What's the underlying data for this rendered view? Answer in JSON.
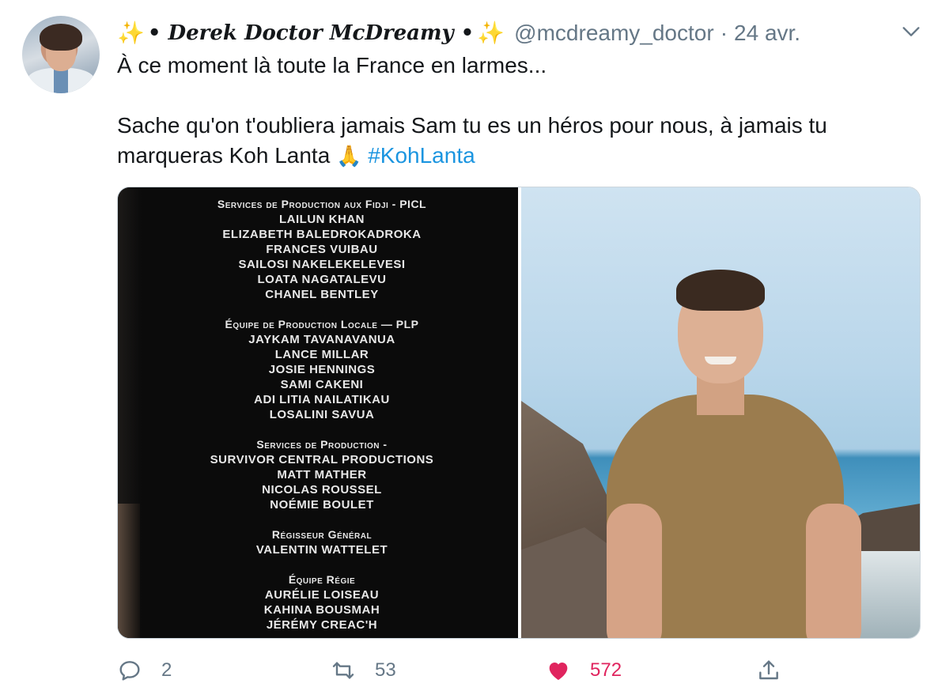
{
  "tweet": {
    "display_name": "• Derek Doctor McDreamy •",
    "sparkle_left": "✨",
    "sparkle_right": "✨",
    "handle": "@mcdreamy_doctor",
    "separator": "·",
    "date": "24 avr.",
    "text_line1": "À ce moment là toute la France en larmes...",
    "text_line2": "Sache qu'on t'oubliera jamais Sam tu es un héros pour nous, à jamais tu",
    "text_line3": "marqueras Koh Lanta",
    "emoji": "🙏",
    "hashtag": "#KohLanta"
  },
  "credits": {
    "sections": [
      {
        "heading": "Services de Production aux Fidji - PICL",
        "names": [
          "LAILUN KHAN",
          "ELIZABETH BALEDROKADROKA",
          "FRANCES VUIBAU",
          "SAILOSI NAKELEKELEVESI",
          "LOATA NAGATALEVU",
          "CHANEL BENTLEY"
        ]
      },
      {
        "heading": "Équipe de Production Locale — PLP",
        "names": [
          "JAYKAM TAVANAVANUA",
          "LANCE MILLAR",
          "JOSIE HENNINGS",
          "SAMI CAKENI",
          "ADI LITIA NAILATIKAU",
          "LOSALINI SAVUA"
        ]
      },
      {
        "heading": "Services de Production -",
        "names": [
          "SURVIVOR CENTRAL PRODUCTIONS",
          "MATT MATHER",
          "NICOLAS ROUSSEL",
          "NOÉMIE BOULET"
        ]
      },
      {
        "heading": "Régisseur Général",
        "names": [
          "VALENTIN WATTELET"
        ]
      },
      {
        "heading": "Équipe Régie",
        "names": [
          "AURÉLIE LOISEAU",
          "KAHINA BOUSMAH",
          "JÉRÉMY CREAC'H"
        ]
      }
    ]
  },
  "actions": {
    "reply_count": "2",
    "retweet_count": "53",
    "like_count": "572"
  },
  "colors": {
    "link": "#1b95e0",
    "muted": "#657786",
    "like": "#e0245e",
    "sparkle": "#f5c23c"
  },
  "icons": [
    "chevron-down-icon",
    "reply-icon",
    "retweet-icon",
    "heart-icon",
    "share-icon"
  ]
}
